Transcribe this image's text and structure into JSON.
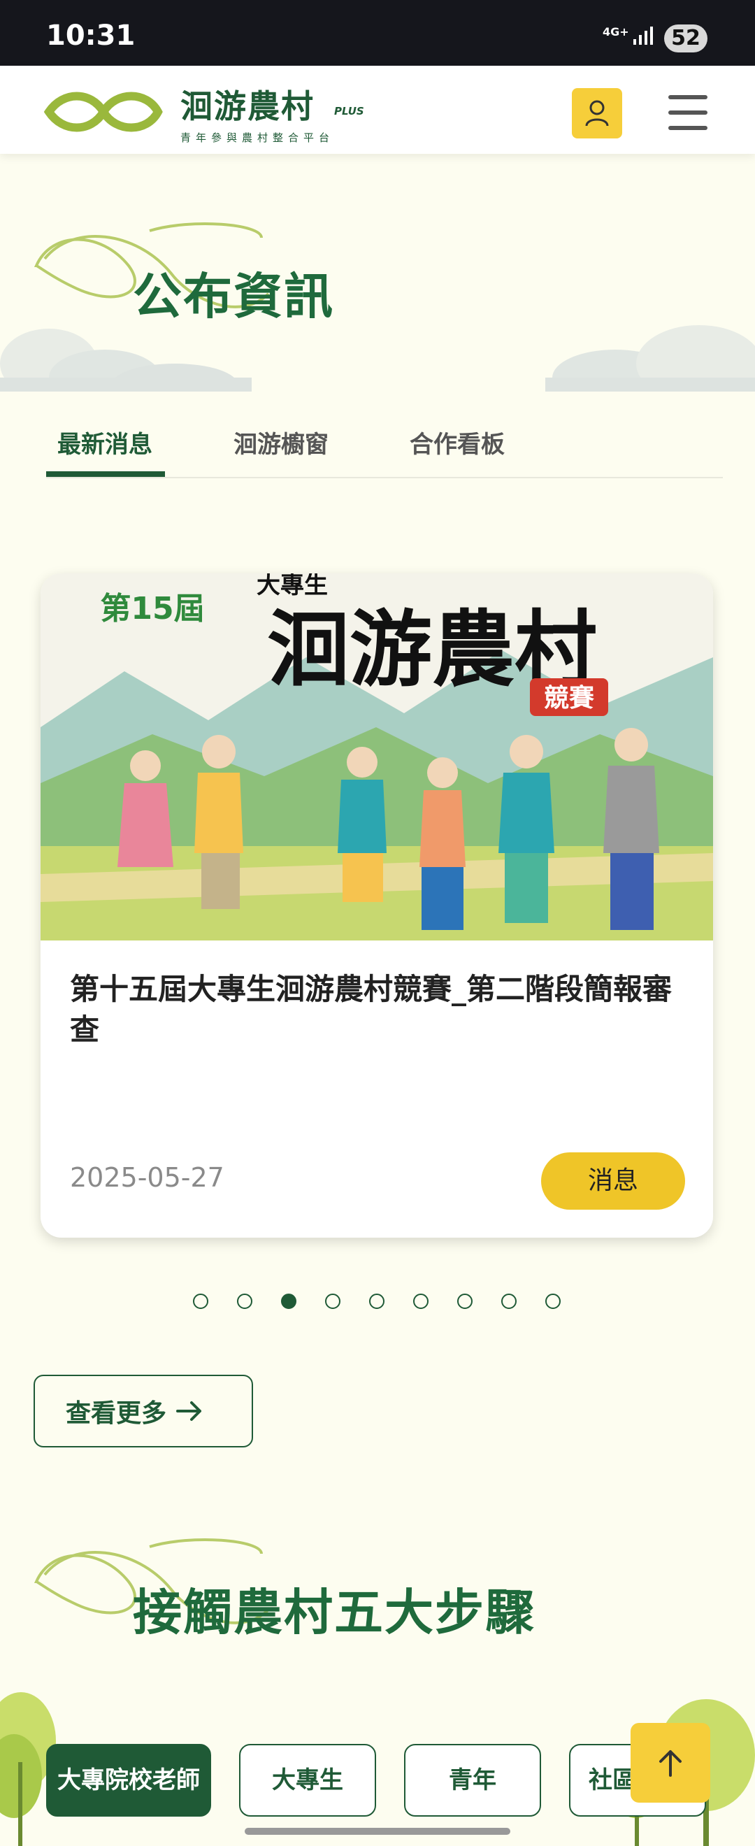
{
  "status_bar": {
    "time": "10:31",
    "network": "4G+",
    "battery": "52"
  },
  "header": {
    "logo_title": "洄游農村",
    "logo_plus": "PLUS",
    "logo_subtitle": "青年參與農村整合平台"
  },
  "announcements": {
    "section_title": "公布資訊",
    "tabs": [
      "最新消息",
      "洄游櫥窗",
      "合作看板"
    ],
    "active_tab_index": 0,
    "card": {
      "image_text": {
        "edition": "第15屆",
        "subtitle": "大專生",
        "title": "洄游農村",
        "suffix": "競賽"
      },
      "title": "第十五屆大專生洄游農村競賽_第二階段簡報審查",
      "date": "2025-05-27",
      "tag": "消息"
    },
    "carousel": {
      "count": 9,
      "active_index": 2
    },
    "more_label": "查看更多"
  },
  "steps": {
    "section_title": "接觸農村五大步驟",
    "categories": [
      "大專院校老師",
      "大專生",
      "青年",
      "社區"
    ],
    "active_category_index": 0
  },
  "colors": {
    "brand_green": "#1f5a36",
    "accent_yellow": "#f6ce3a",
    "background": "#fdfdf0"
  }
}
